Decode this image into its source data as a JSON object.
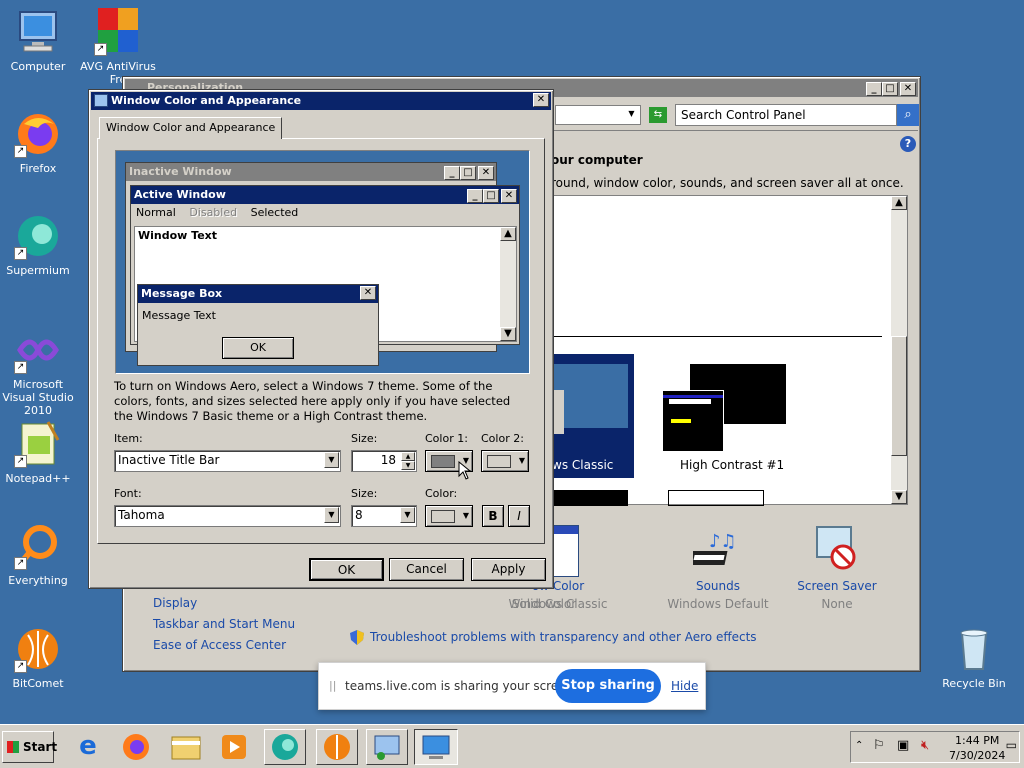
{
  "desktop": {
    "icons": [
      {
        "label": "Computer"
      },
      {
        "label": "AVG AntiVirus Fre"
      },
      {
        "label": "Firefox"
      },
      {
        "label": "Supermium"
      },
      {
        "label": "Microsoft Visual Studio 2010"
      },
      {
        "label": "Notepad++"
      },
      {
        "label": "Everything"
      },
      {
        "label": "BitComet"
      },
      {
        "label": "Recycle Bin"
      }
    ]
  },
  "personalization": {
    "title": "Personalization",
    "search_placeholder": "Search Control Panel",
    "heading": "our computer",
    "subtext": "round, window color, sounds, and screen saver all at once.",
    "themes": [
      {
        "label": "ws Classic"
      },
      {
        "label": "High Contrast #1"
      }
    ],
    "bottom_items": [
      {
        "label": "ow Color",
        "value": "Solid Color"
      },
      {
        "label": "Windows Classic"
      },
      {
        "label": "Sounds",
        "value": "Windows Default"
      },
      {
        "label": "Screen Saver",
        "value": "None"
      }
    ],
    "see_also": [
      "Display",
      "Taskbar and Start Menu",
      "Ease of Access Center"
    ],
    "troubleshoot": "Troubleshoot problems with transparency and other Aero effects"
  },
  "dialog": {
    "title": "Window Color and Appearance",
    "tab": "Window Color and Appearance",
    "preview": {
      "inactive_title": "Inactive Window",
      "active_title": "Active Window",
      "menu": [
        "Normal",
        "Disabled",
        "Selected"
      ],
      "window_text": "Window Text",
      "msgbox_title": "Message Box",
      "msgbox_text": "Message Text",
      "msgbox_ok": "OK"
    },
    "info_text": "To turn on Windows Aero, select a Windows 7 theme.  Some of the colors, fonts, and sizes selected here apply only if you have selected the Windows 7 Basic theme or a High Contrast theme.",
    "item_label": "Item:",
    "item_value": "Inactive Title Bar",
    "size_label": "Size:",
    "size_value": "18",
    "color1_label": "Color 1:",
    "color2_label": "Color 2:",
    "font_label": "Font:",
    "font_value": "Tahoma",
    "font_size_label": "Size:",
    "font_size_value": "8",
    "font_color_label": "Color:",
    "bold": "B",
    "italic": "I",
    "ok": "OK",
    "cancel": "Cancel",
    "apply": "Apply"
  },
  "sharing_bar": {
    "text": "teams.live.com is sharing your screen.",
    "stop": "Stop sharing",
    "hide": "Hide"
  },
  "taskbar": {
    "start": "Start",
    "time": "1:44 PM",
    "date": "7/30/2024"
  },
  "colors": {
    "desktop": "#3a6ea5",
    "active_title": "#0a246a",
    "inactive_title": "#808080",
    "stop_sharing": "#1d6ee0"
  }
}
